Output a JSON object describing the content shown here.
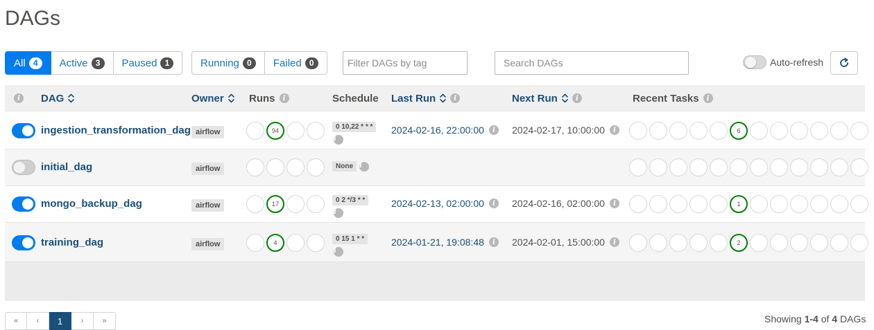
{
  "page": {
    "title": "DAGs"
  },
  "status_filter": [
    {
      "label": "All",
      "count": "4",
      "active": true
    },
    {
      "label": "Active",
      "count": "3",
      "active": false
    },
    {
      "label": "Paused",
      "count": "1",
      "active": false
    }
  ],
  "run_filter": [
    {
      "label": "Running",
      "count": "0"
    },
    {
      "label": "Failed",
      "count": "0"
    }
  ],
  "tag_filter": {
    "placeholder": "Filter DAGs by tag"
  },
  "search": {
    "placeholder": "Search DAGs"
  },
  "autorefresh": {
    "label": "Auto-refresh",
    "enabled": false
  },
  "columns": {
    "dag": "DAG",
    "owner": "Owner",
    "runs": "Runs",
    "schedule": "Schedule",
    "last_run": "Last Run",
    "next_run": "Next Run",
    "recent_tasks": "Recent Tasks"
  },
  "dags": [
    {
      "name": "ingestion_transformation_dag",
      "enabled": true,
      "owner": "airflow",
      "runs": [
        "",
        "94",
        "",
        ""
      ],
      "schedule": "0 10,22 * * *",
      "last_run": "2024-02-16, 22:00:00",
      "next_run": "2024-02-17, 10:00:00",
      "recent_tasks": [
        "",
        "",
        "",
        "",
        "",
        "6",
        "",
        "",
        "",
        "",
        "",
        ""
      ]
    },
    {
      "name": "initial_dag",
      "enabled": false,
      "owner": "airflow",
      "runs": [
        "",
        "",
        "",
        ""
      ],
      "schedule": "None",
      "last_run": "",
      "next_run": "",
      "recent_tasks": [
        "",
        "",
        "",
        "",
        "",
        "",
        "",
        "",
        "",
        "",
        "",
        ""
      ]
    },
    {
      "name": "mongo_backup_dag",
      "enabled": true,
      "owner": "airflow",
      "runs": [
        "",
        "17",
        "",
        ""
      ],
      "schedule": "0 2 */3 * *",
      "last_run": "2024-02-13, 02:00:00",
      "next_run": "2024-02-16, 02:00:00",
      "recent_tasks": [
        "",
        "",
        "",
        "",
        "",
        "1",
        "",
        "",
        "",
        "",
        "",
        ""
      ]
    },
    {
      "name": "training_dag",
      "enabled": true,
      "owner": "airflow",
      "runs": [
        "",
        "4",
        "",
        ""
      ],
      "schedule": "0 15 1 * *",
      "last_run": "2024-01-21, 19:08:48",
      "next_run": "2024-02-01, 15:00:00",
      "recent_tasks": [
        "",
        "",
        "",
        "",
        "",
        "2",
        "",
        "",
        "",
        "",
        "",
        ""
      ]
    }
  ],
  "pagination": {
    "first": "«",
    "prev": "‹",
    "current": "1",
    "next": "›",
    "last": "»",
    "showing_prefix": "Showing",
    "range": "1-4",
    "of": "of",
    "total": "4",
    "suffix": "DAGs"
  }
}
